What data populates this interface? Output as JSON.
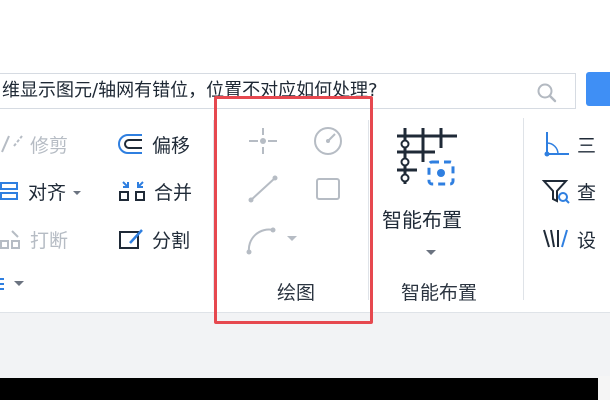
{
  "search": {
    "text": "维显示图元/轴网有错位，位置不对应如何处理?"
  },
  "ribbon": {
    "edit_group": {
      "trim_label": "修剪",
      "align_label": "对齐",
      "break_label": "打断",
      "offset_label": "偏移",
      "merge_label": "合并",
      "split_label": "分割"
    },
    "drawing_group": {
      "label": "绘图"
    },
    "smart_group": {
      "button_label": "智能布置",
      "label": "智能布置"
    },
    "right_group": {
      "item1_label": "三",
      "item2_label": "查",
      "item3_label": "设"
    }
  },
  "colors": {
    "accent_blue": "#2f7fe0",
    "highlight_red": "#e6484f",
    "disabled_gray": "#b6bcc4"
  }
}
